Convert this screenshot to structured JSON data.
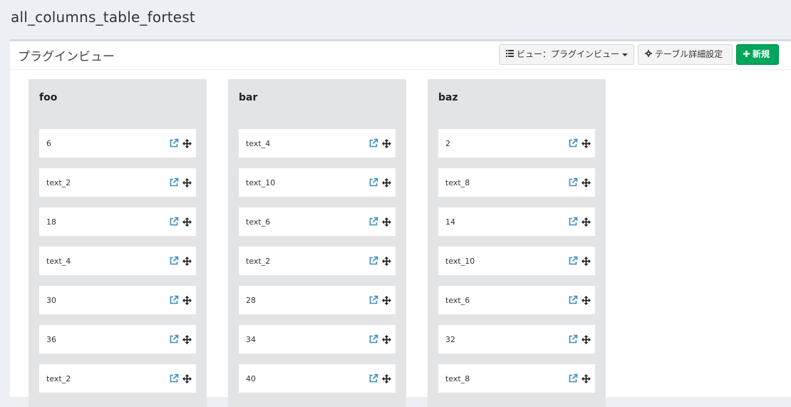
{
  "page": {
    "title": "all_columns_table_fortest"
  },
  "panel": {
    "title": "プラグインビュー",
    "buttons": {
      "view_label": "ビュー：プラグインビュー",
      "settings_label": "テーブル詳細設定",
      "new_label": "新規"
    }
  },
  "colors": {
    "accent": "#00a65a",
    "link_icon": "#3c8dbc",
    "column_bg": "#e3e4e6"
  },
  "icons": [
    "list-icon",
    "gear-icon",
    "plus-icon",
    "external-link-icon",
    "move-icon"
  ],
  "columns": [
    {
      "title": "foo",
      "cards": [
        "6",
        "text_2",
        "18",
        "text_4",
        "30",
        "36",
        "text_2"
      ]
    },
    {
      "title": "bar",
      "cards": [
        "text_4",
        "text_10",
        "text_6",
        "text_2",
        "28",
        "34",
        "40"
      ]
    },
    {
      "title": "baz",
      "cards": [
        "2",
        "text_8",
        "14",
        "text_10",
        "text_6",
        "32",
        "text_8"
      ]
    }
  ]
}
